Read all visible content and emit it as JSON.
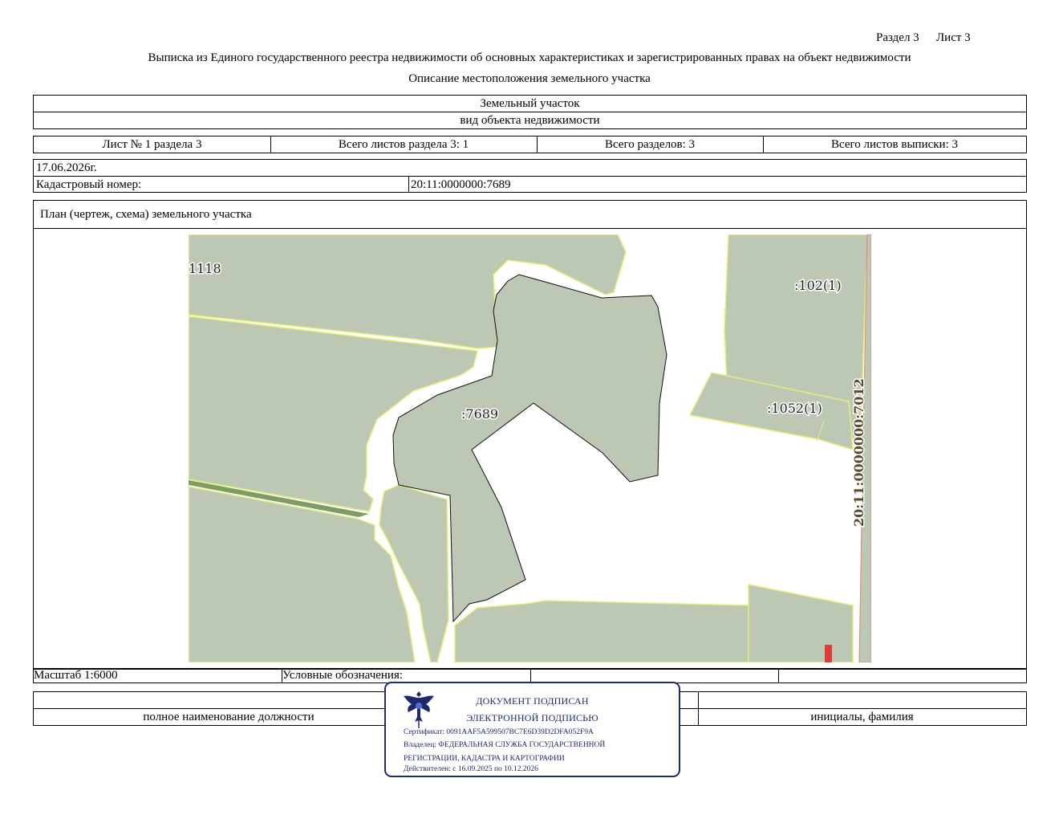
{
  "header": {
    "section": "Раздел 3",
    "sheet": "Лист 3",
    "title": "Выписка из Единого государственного реестра недвижимости об основных характеристиках и зарегистрированных правах на объект недвижимости",
    "subtitle": "Описание местоположения земельного участка"
  },
  "object": {
    "type_value": "Земельный участок",
    "type_caption": "вид объекта недвижимости"
  },
  "sheets": {
    "sheet_no": "Лист № 1 раздела 3",
    "section_sheets": "Всего листов раздела 3: 1",
    "total_sections": "Всего разделов: 3",
    "total_sheets": "Всего листов выписки: 3"
  },
  "info": {
    "date": "17.06.2026г.",
    "cadastral_label": "Кадастровый номер:",
    "cadastral_value": "20:11:0000000:7689"
  },
  "plan": {
    "title": "План (чертеж, схема) земельного участка",
    "labels": {
      "left_parcel": "1118",
      "main_parcel": ":7689",
      "parcel_102": ":102(1)",
      "parcel_1052": ":1052(1)",
      "road": "20:11:0000000:7012"
    },
    "colors": {
      "parcel_fill": "#bcc8b3",
      "parcel_border": "#e2f07a",
      "strip": "#7f9c63",
      "marker": "#e03a3a"
    }
  },
  "footer": {
    "scale": "Масштаб 1:6000",
    "legend": "Условные обозначения:",
    "position_caption": "полное наименование должности",
    "name_caption": "инициалы, фамилия"
  },
  "stamp": {
    "line1": "ДОКУМЕНТ ПОДПИСАН",
    "line2": "ЭЛЕКТРОННОЙ ПОДПИСЬЮ",
    "certificate": "Сертификат: 0091AAF5A599507BC7E6D39D2DFA052F9A",
    "owner_line1": "Владелец: ФЕДЕРАЛЬНАЯ СЛУЖБА ГОСУДАРСТВЕННОЙ",
    "owner_line2": "РЕГИСТРАЦИИ, КАДАСТРА И КАРТОГРАФИИ",
    "valid": "Действителен: с 16.09.2025 по 10.12.2026",
    "color": "#1d2a6b"
  }
}
